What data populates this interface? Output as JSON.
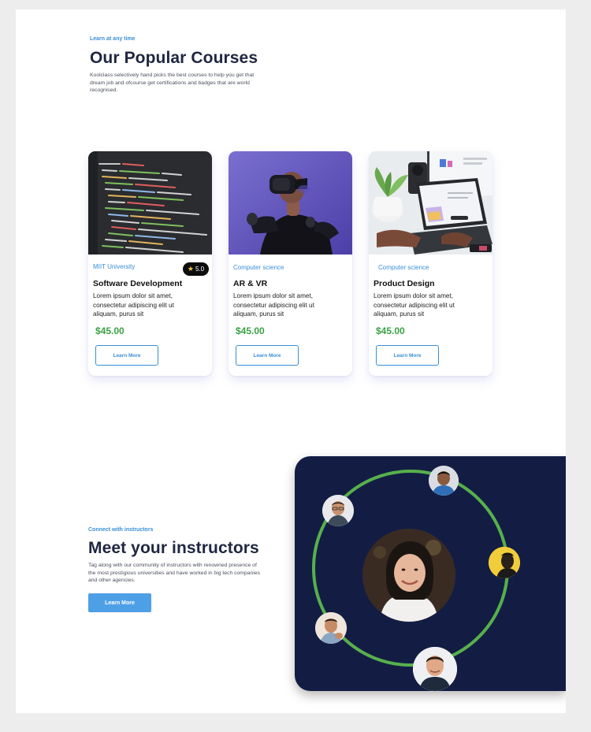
{
  "courses_section": {
    "eyebrow": "Learn at any time",
    "title": "Our Popular Courses",
    "description_line1": "Koolclass selectively hand picks the best courses to help you get that",
    "description_line2": "dream job and ofcourse get certifications and badges that are world",
    "description_line3": "recognised."
  },
  "courses": [
    {
      "category": "MIIT University",
      "title": "Software Development",
      "desc_line1": "Lorem ipsum dolor sit amet,",
      "desc_line2": "consectetur adipiscing elit ut",
      "desc_line3": "aliquam, purus sit",
      "price": "$45.00",
      "button": "Learn More",
      "rating": "5.0",
      "image": "code-editor-photo"
    },
    {
      "category": "Computer science",
      "title": "AR & VR",
      "desc_line1": "Lorem ipsum dolor sit amet,",
      "desc_line2": "consectetur adipiscing elit ut",
      "desc_line3": "aliquam, purus sit",
      "price": "$45.00",
      "button": "Learn More",
      "image": "vr-headset-photo"
    },
    {
      "category": "Computer science",
      "title": "Product Design",
      "desc_line1": "Lorem ipsum dolor sit amet,",
      "desc_line2": "consectetur adipiscing elit ut",
      "desc_line3": "aliquam, purus sit",
      "price": "$45.00",
      "button": "Learn More",
      "image": "laptop-desk-photo"
    }
  ],
  "instructors_section": {
    "eyebrow": "Connect with instructors",
    "title": "Meet your instructors",
    "description_line1": "Tag along with our community of instructors with renowned presence of",
    "description_line2": "the most prestigious universities and have worked in big tech companies",
    "description_line3": "and other agencies.",
    "button": "Learn More"
  },
  "colors": {
    "accent_blue": "#3a8fd6",
    "price_green": "#3aa144",
    "panel_navy": "#131d44",
    "orbit_green": "#57b04c",
    "button_blue": "#4ea0e6"
  }
}
